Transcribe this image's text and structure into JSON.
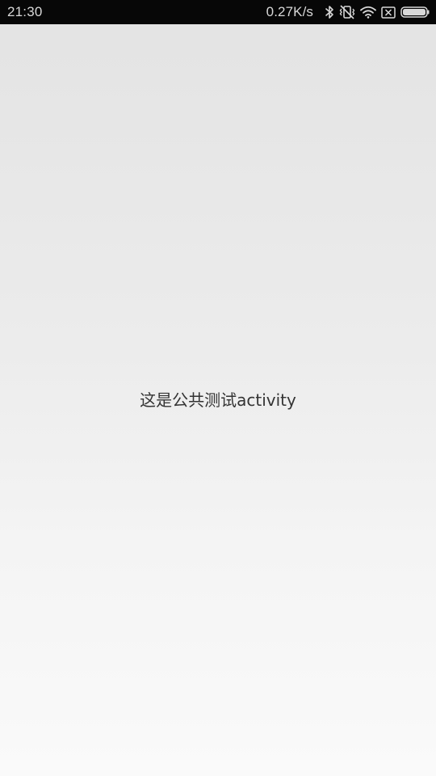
{
  "status_bar": {
    "time": "21:30",
    "network_speed": "0.27K/s",
    "icons": [
      "bluetooth-icon",
      "vibrate-off-icon",
      "wifi-icon",
      "no-sim-icon",
      "battery-icon"
    ]
  },
  "main": {
    "text": "这是公共测试activity"
  },
  "colors": {
    "status_bar_bg": "#070707",
    "status_bar_fg": "#d8d8d8",
    "text": "#333333"
  }
}
